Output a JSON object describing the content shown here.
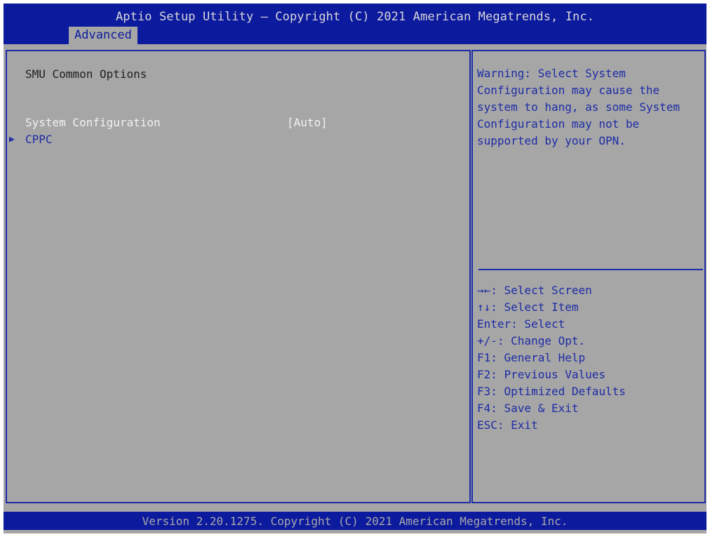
{
  "header": {
    "title": "Aptio Setup Utility – Copyright (C) 2021 American Megatrends, Inc.",
    "active_tab": "Advanced"
  },
  "main": {
    "section_title": "SMU Common Options",
    "items": [
      {
        "label": "System Configuration",
        "value": "[Auto]",
        "type": "option"
      },
      {
        "label": "CPPC",
        "value": "",
        "type": "submenu"
      }
    ]
  },
  "help": {
    "lines": [
      "Warning: Select System",
      "Configuration may cause the",
      "system to hang, as some System",
      "Configuration may not be",
      "supported by your OPN."
    ]
  },
  "keys": [
    "→←: Select Screen",
    "↑↓: Select Item",
    "Enter: Select",
    "+/-: Change Opt.",
    "F1: General Help",
    "F2: Previous Values",
    "F3: Optimized Defaults",
    "F4: Save & Exit",
    "ESC: Exit"
  ],
  "footer": {
    "text": "Version 2.20.1275. Copyright (C) 2021 American Megatrends, Inc."
  },
  "colors": {
    "bios_blue": "#0c1a9e",
    "panel_gray": "#a6a6a6",
    "accent_blue": "#1e2ca6"
  }
}
